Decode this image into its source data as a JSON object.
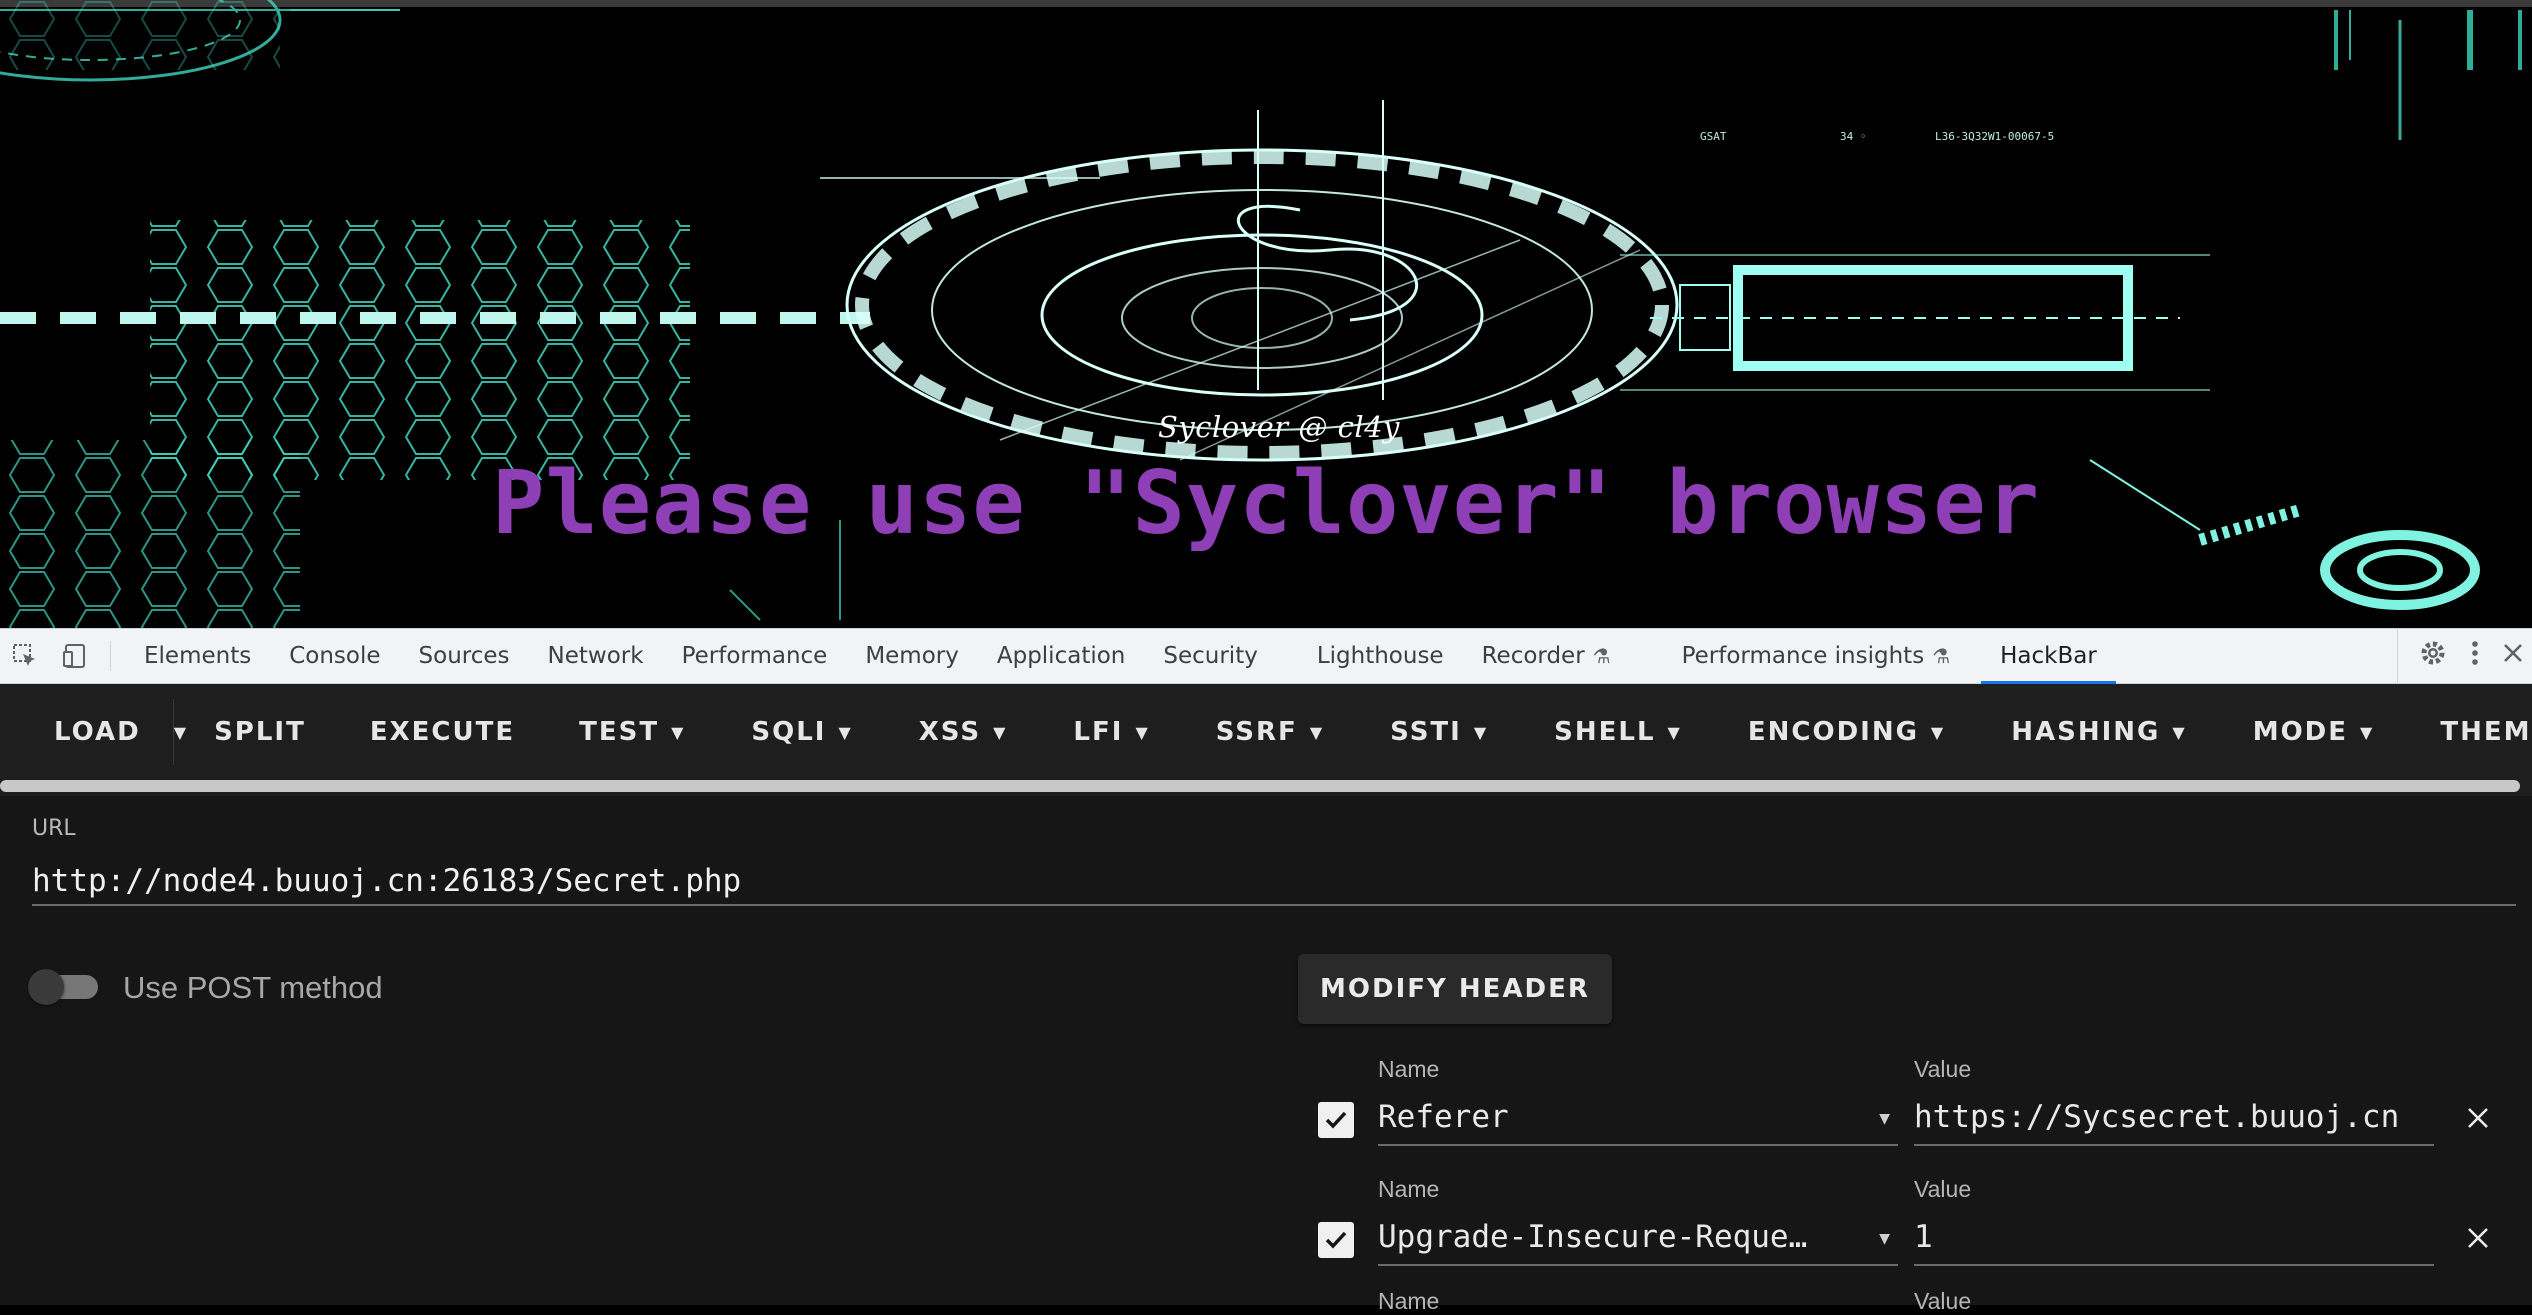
{
  "page": {
    "watermark": "Syclover @ cl4y",
    "headline": "Please use \"Syclover\" browser"
  },
  "devtools": {
    "tabs": [
      {
        "label": "Elements"
      },
      {
        "label": "Console"
      },
      {
        "label": "Sources"
      },
      {
        "label": "Network"
      },
      {
        "label": "Performance"
      },
      {
        "label": "Memory"
      },
      {
        "label": "Application"
      },
      {
        "label": "Security"
      },
      {
        "label": "Lighthouse"
      },
      {
        "label": "Recorder"
      },
      {
        "label": "Performance insights"
      },
      {
        "label": "HackBar"
      }
    ],
    "active_tab": "HackBar",
    "icons": [
      "inspect-element-icon",
      "device-toolbar-icon",
      "flask-icon",
      "gear-icon",
      "kebab-menu-icon",
      "close-icon"
    ]
  },
  "hackbar": {
    "toolbar": {
      "load": "LOAD",
      "split": "SPLIT",
      "execute": "EXECUTE",
      "test": "TEST",
      "sqli": "SQLI",
      "xss": "XSS",
      "lfi": "LFI",
      "ssrf": "SSRF",
      "ssti": "SSTI",
      "shell": "SHELL",
      "encoding": "ENCODING",
      "hashing": "HASHING",
      "mode": "MODE",
      "theme": "THEME"
    },
    "url_label": "URL",
    "url_value": "http://node4.buuoj.cn:26183/Secret.php",
    "post_label": "Use POST method",
    "post_enabled": false,
    "modify_header_label": "MODIFY HEADER",
    "headers": [
      {
        "name_label": "Name",
        "name": "Referer",
        "value_label": "Value",
        "value": "https://Sycsecret.buuoj.cn",
        "checked": true
      },
      {
        "name_label": "Name",
        "name": "Upgrade-Insecure-Reque…",
        "value_label": "Value",
        "value": "1",
        "checked": true
      }
    ],
    "partial_row": {
      "name_label": "Name",
      "value_label": "Value"
    }
  },
  "colors": {
    "headline": "#8e3fb5",
    "hackbar_bg": "#161616",
    "accent": "#1a73e8",
    "art": "#41e0c8"
  }
}
